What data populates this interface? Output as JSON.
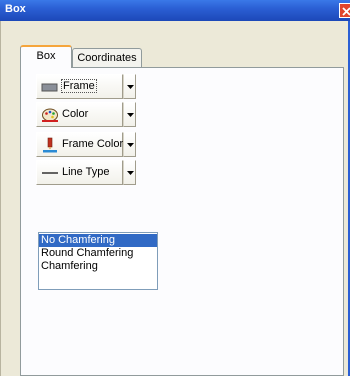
{
  "window": {
    "title": "Box"
  },
  "tabs": [
    {
      "label": "Box",
      "selected": true
    },
    {
      "label": "Coordinates",
      "selected": false
    }
  ],
  "buttons": {
    "frame": {
      "label": "Frame",
      "icon": "frame-rect-icon"
    },
    "color": {
      "label": "Color",
      "icon": "palette-icon"
    },
    "frame_color": {
      "label": "Frame Color",
      "icon": "pen-color-icon"
    },
    "line_type": {
      "label": "Line Type",
      "icon": "line-icon"
    }
  },
  "chamfer_list": {
    "options": [
      "No Chamfering",
      "Round Chamfering",
      "Chamfering"
    ],
    "selected": "No Chamfering"
  },
  "colors": {
    "titlebar": "#2b5fd4",
    "selection": "#316ac5",
    "tab_accent": "#f5a53c"
  }
}
